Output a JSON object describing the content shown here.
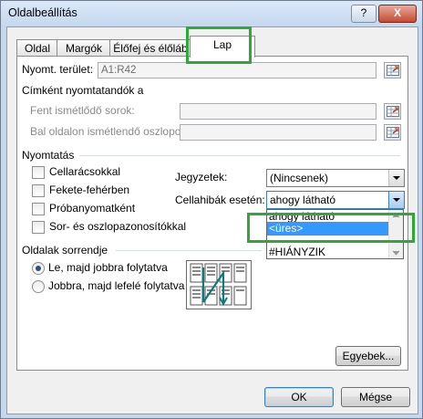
{
  "window": {
    "title": "Oldalbeállítás",
    "help_label": "?",
    "close_label": "X"
  },
  "tabs": [
    "Oldal",
    "Margók",
    "Élőfej és élőláb",
    "Lap"
  ],
  "print_area": {
    "label": "Nyomt. terület:",
    "value": "A1:R42"
  },
  "print_titles": {
    "title": "Címként nyomtatandók a",
    "rows_label": "Fent ismétlődő sorok:",
    "cols_label": "Bal oldalon ismétlendő oszlopok:"
  },
  "print": {
    "title": "Nyomtatás",
    "checkboxes": [
      "Cellarácsokkal",
      "Fekete-fehérben",
      "Próbanyomatként",
      "Sor- és oszlopazonosítókkal"
    ],
    "comments_label": "Jegyzetek:",
    "comments_value": "(Nincsenek)",
    "errors_label": "Cellahibák esetén:",
    "errors_value": "ahogy látható",
    "errors_options": [
      "ahogy látható",
      "<üres>",
      "--",
      "#HIÁNYZIK"
    ],
    "errors_highlighted": "<üres>"
  },
  "page_order": {
    "title": "Oldalak sorrendje",
    "options": [
      "Le, majd jobbra folytatva",
      "Jobbra, majd lefelé folytatva"
    ],
    "selected": "Le, majd jobbra folytatva"
  },
  "buttons": {
    "options": "Egyebek...",
    "ok": "OK",
    "cancel": "Mégse"
  },
  "colors": {
    "highlight_green": "#2fa836",
    "selection_blue": "#3399ff"
  }
}
